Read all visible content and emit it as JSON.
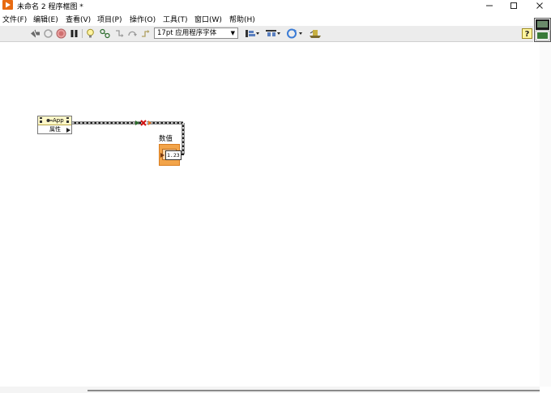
{
  "window": {
    "title": "未命名 2 程序框图 *",
    "controls": {
      "minimize": "─",
      "maximize": "□",
      "close": "✕"
    }
  },
  "menu": {
    "items": [
      "文件(F)",
      "编辑(E)",
      "查看(V)",
      "项目(P)",
      "操作(O)",
      "工具(T)",
      "窗口(W)",
      "帮助(H)"
    ]
  },
  "toolbar": {
    "font": "17pt 应用程序字体",
    "icons": [
      "run-arrow-icon",
      "run-continuously-icon",
      "abort-icon",
      "pause-icon",
      "highlight-execution-icon",
      "retain-wire-values-icon",
      "step-into-icon",
      "step-over-icon",
      "step-out-icon",
      "align-icon",
      "distribute-icon",
      "reorder-icon",
      "clean-up-icon",
      "context-help-icon"
    ]
  },
  "diagram": {
    "property_node": {
      "class": "App",
      "property": "属性"
    },
    "indicator": {
      "label": "数值",
      "display": "1.23"
    }
  },
  "colors": {
    "accent": "#e86a10",
    "wire": "#1a1a1a",
    "broken_wire_x": "#d01010",
    "indicator_fill": "#f2a44a",
    "property_header": "#fff8c8"
  }
}
